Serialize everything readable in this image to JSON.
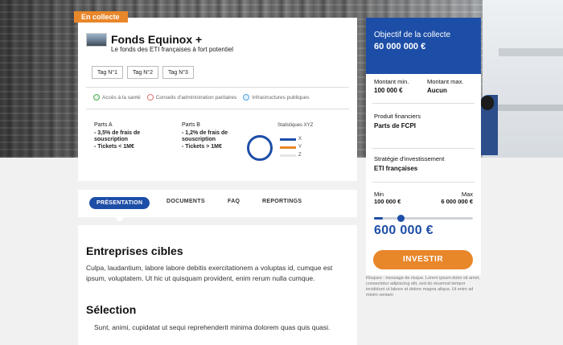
{
  "badge": "En collecte",
  "fund": {
    "name": "Fonds Equinox +",
    "subtitle": "Le fonds des ETI françaises à fort potentiel",
    "tags": [
      "Tag N°1",
      "Tag N°2",
      "Tag N°3"
    ],
    "features": [
      "Accès à la santé",
      "Conseils d'administration paritaires",
      "Infrastructures publiques"
    ],
    "parts": [
      {
        "title": "Parts A",
        "line1": "- 3,5% de frais de",
        "line2": "souscription",
        "line3": "- Tickets < 1M€"
      },
      {
        "title": "Parts B",
        "line1": "- 1,2% de frais de",
        "line2": "souscription",
        "line3": "- Tickets > 1M€"
      }
    ],
    "stats": {
      "title": "Statistiques XYZ",
      "legend": [
        {
          "label": "X",
          "color": "#1d4ea7"
        },
        {
          "label": "Y",
          "color": "#e8862a"
        },
        {
          "label": "Z",
          "color": "#e6e6e6"
        }
      ]
    }
  },
  "tabs": [
    "PRÉSENTATION",
    "DOCUMENTS",
    "FAQ",
    "REPORTINGS"
  ],
  "content": {
    "h1": "Entreprises cibles",
    "p1": "Culpa, laudantium, labore labore debitis exercitationem a voluptas id, cumque est ipsum, voluptatem. Ut hic ut quisquam provident, enim rerum nulla cumque.",
    "h2": "Sélection",
    "p2": "Sunt, animi, cupidatat ut sequi reprehenderit minima dolorem quas quis quasi."
  },
  "panel": {
    "objective_label": "Objectif de la collecte",
    "objective_value": "60 000 000 €",
    "min_label": "Montant min.",
    "min_value": "100 000 €",
    "max_label": "Montant max.",
    "max_value": "Aucun",
    "product_label": "Produit financiers",
    "product_value": "Parts de FCPI",
    "strategy_label": "Stratégie d'investissement",
    "strategy_value": "ETI françaises",
    "slider_min_label": "Min",
    "slider_min_value": "100 000 €",
    "slider_max_label": "Max",
    "slider_max_value": "6 000 000 €",
    "slider_fraction": 0.09,
    "amount": "600 000 €",
    "invest_label": "INVESTIR",
    "risk_text": "Risques : message de risque. Lorem ipsum dolor sit amet, consectetur adipiscing elit, sed do eiusmod tempor incididunt ut labore et dolore magna aliqua. Ut enim ad minim veniam"
  }
}
